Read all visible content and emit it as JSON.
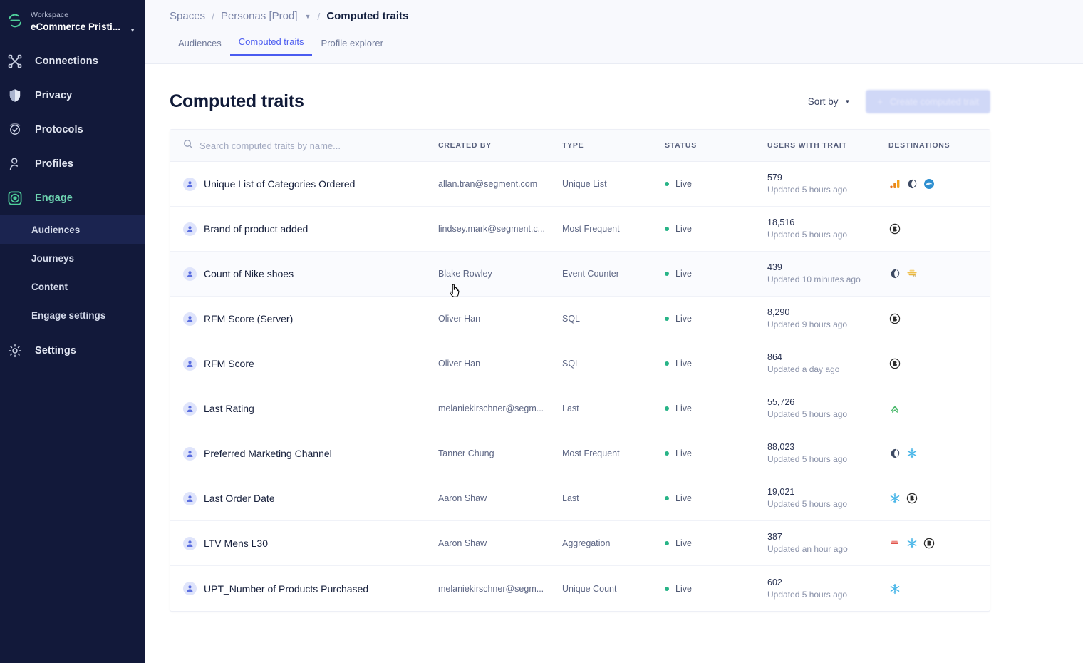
{
  "sidebar": {
    "workspace_label": "Workspace",
    "workspace_name": "eCommerce Pristi...",
    "items": [
      {
        "label": "Connections",
        "icon": "connections-icon"
      },
      {
        "label": "Privacy",
        "icon": "shield-icon"
      },
      {
        "label": "Protocols",
        "icon": "protocols-icon"
      },
      {
        "label": "Profiles",
        "icon": "person-icon"
      },
      {
        "label": "Engage",
        "icon": "engage-icon"
      }
    ],
    "subitems": [
      {
        "label": "Audiences"
      },
      {
        "label": "Journeys"
      },
      {
        "label": "Content"
      },
      {
        "label": "Engage settings"
      }
    ],
    "settings": {
      "label": "Settings",
      "icon": "gear-icon"
    },
    "active_item": "Engage",
    "active_subitem": "Audiences",
    "accent_color": "#6fd6b2",
    "background_color": "#12193a"
  },
  "breadcrumb": {
    "spaces": "Spaces",
    "space": "Personas [Prod]",
    "current": "Computed traits",
    "separator": "/"
  },
  "tabs": [
    {
      "label": "Audiences",
      "active": false
    },
    {
      "label": "Computed traits",
      "active": true
    },
    {
      "label": "Profile explorer",
      "active": false
    }
  ],
  "page": {
    "title": "Computed traits",
    "sort_by_label": "Sort by",
    "create_button_label": "Create computed trait",
    "create_button_icon": "plus-icon"
  },
  "search": {
    "placeholder": "Search computed traits by name...",
    "value": "",
    "icon": "search-icon"
  },
  "table": {
    "columns": [
      "CREATED BY",
      "TYPE",
      "STATUS",
      "USERS WITH TRAIT",
      "DESTINATIONS"
    ],
    "rows": [
      {
        "name": "Unique List of Categories Ordered",
        "created_by": "allan.tran@segment.com",
        "type": "Unique List",
        "status": "Live",
        "users": "579",
        "updated": "Updated 5 hours ago",
        "destinations": [
          "google-analytics-icon",
          "moon-icon",
          "blue-globe-icon"
        ],
        "hover": false
      },
      {
        "name": "Brand of product added",
        "created_by": "lindsey.mark@segment.c...",
        "type": "Most Frequent",
        "status": "Live",
        "users": "18,516",
        "updated": "Updated 5 hours ago",
        "destinations": [
          "braze-icon"
        ],
        "hover": false
      },
      {
        "name": "Count of Nike shoes",
        "created_by": "Blake Rowley",
        "type": "Event Counter",
        "status": "Live",
        "users": "439",
        "updated": "Updated 10 minutes ago",
        "destinations": [
          "moon-icon",
          "amplitude-icon"
        ],
        "hover": true
      },
      {
        "name": "RFM Score (Server)",
        "created_by": "Oliver Han",
        "type": "SQL",
        "status": "Live",
        "users": "8,290",
        "updated": "Updated 9 hours ago",
        "destinations": [
          "braze-icon"
        ],
        "hover": false
      },
      {
        "name": "RFM Score",
        "created_by": "Oliver Han",
        "type": "SQL",
        "status": "Live",
        "users": "864",
        "updated": "Updated a day ago",
        "destinations": [
          "braze-icon"
        ],
        "hover": false
      },
      {
        "name": "Last Rating",
        "created_by": "melaniekirschner@segm...",
        "type": "Last",
        "status": "Live",
        "users": "55,726",
        "updated": "Updated 5 hours ago",
        "destinations": [
          "green-tree-icon"
        ],
        "hover": false
      },
      {
        "name": "Preferred Marketing Channel",
        "created_by": "Tanner Chung",
        "type": "Most Frequent",
        "status": "Live",
        "users": "88,023",
        "updated": "Updated 5 hours ago",
        "destinations": [
          "moon-icon",
          "snowflake-icon"
        ],
        "hover": false
      },
      {
        "name": "Last Order Date",
        "created_by": "Aaron Shaw",
        "type": "Last",
        "status": "Live",
        "users": "19,021",
        "updated": "Updated 5 hours ago",
        "destinations": [
          "snowflake-icon",
          "braze-icon"
        ],
        "hover": false
      },
      {
        "name": "LTV Mens L30",
        "created_by": "Aaron Shaw",
        "type": "Aggregation",
        "status": "Live",
        "users": "387",
        "updated": "Updated an hour ago",
        "destinations": [
          "red-small-icon",
          "snowflake-icon",
          "braze-icon"
        ],
        "hover": false
      },
      {
        "name": "UPT_Number of Products Purchased",
        "created_by": "melaniekirschner@segm...",
        "type": "Unique Count",
        "status": "Live",
        "users": "602",
        "updated": "Updated 5 hours ago",
        "destinations": [
          "snowflake-icon"
        ],
        "hover": false
      }
    ]
  },
  "colors": {
    "status_live": "#28b487",
    "tab_active": "#4b5cf0",
    "trait_icon_bg": "#dfe4fb"
  }
}
